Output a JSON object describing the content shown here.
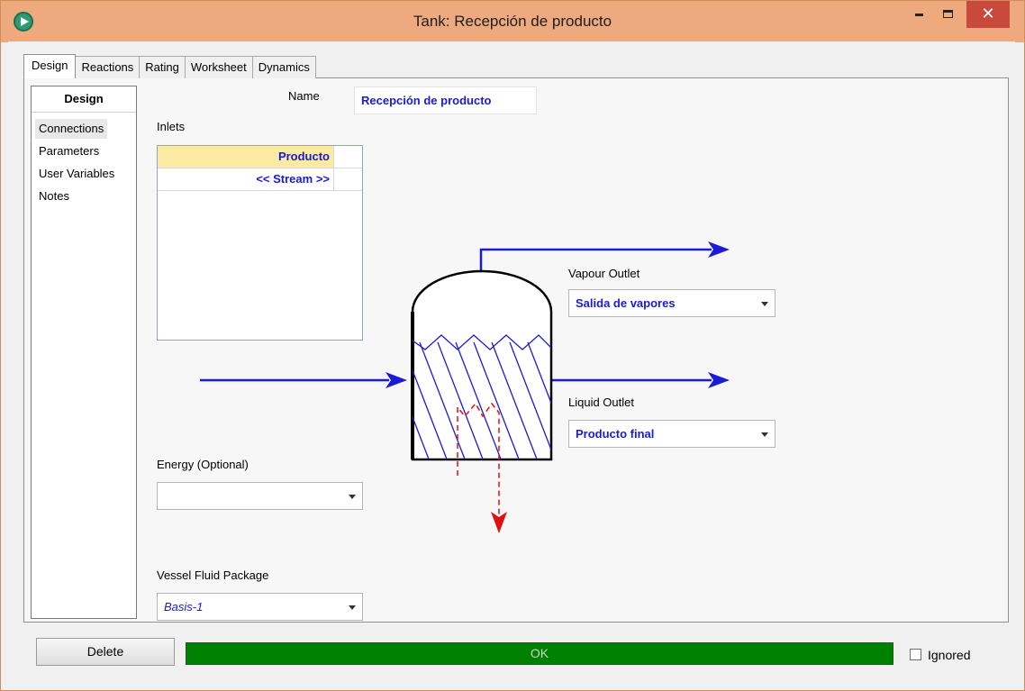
{
  "window": {
    "title": "Tank: Recepción de producto",
    "close_glyph": "✕"
  },
  "tabs": [
    {
      "label": "Design",
      "active": true
    },
    {
      "label": "Reactions"
    },
    {
      "label": "Rating"
    },
    {
      "label": "Worksheet"
    },
    {
      "label": "Dynamics"
    }
  ],
  "sidebar": {
    "header": "Design",
    "items": [
      {
        "label": "Connections",
        "selected": true
      },
      {
        "label": "Parameters"
      },
      {
        "label": "User Variables"
      },
      {
        "label": "Notes"
      }
    ]
  },
  "name": {
    "label": "Name",
    "value": "Recepción de producto"
  },
  "inlets": {
    "label": "Inlets",
    "rows": [
      "Producto",
      "<< Stream >>"
    ]
  },
  "vapour_outlet": {
    "label": "Vapour Outlet",
    "value": "Salida de vapores"
  },
  "liquid_outlet": {
    "label": "Liquid Outlet",
    "value": "Producto final"
  },
  "energy": {
    "label": "Energy (Optional)",
    "value": ""
  },
  "fluid_package": {
    "label": "Vessel Fluid Package",
    "value": "Basis-1"
  },
  "footer": {
    "delete_label": "Delete",
    "status_text": "OK",
    "ignored_label": "Ignored",
    "ignored_checked": false
  },
  "colors": {
    "title_bar": "#eeaa7e",
    "stream_blue": "#1a1ad9",
    "energy_red": "#e01010",
    "status_green": "#008000"
  }
}
